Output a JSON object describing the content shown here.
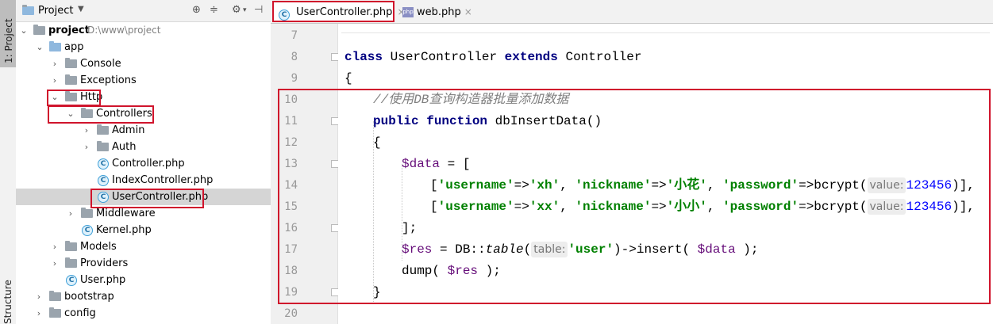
{
  "side_strip": {
    "project_tab": "1: Project",
    "structure_tab": "Structure"
  },
  "project_panel": {
    "title": "Project",
    "items": [
      {
        "label": "project",
        "path": "D:\\www\\project",
        "type": "folder-root",
        "expanded": true
      },
      {
        "label": "app",
        "type": "folder-blue",
        "expanded": true
      },
      {
        "label": "Console",
        "type": "folder",
        "expanded": false
      },
      {
        "label": "Exceptions",
        "type": "folder",
        "expanded": false
      },
      {
        "label": "Http",
        "type": "folder",
        "expanded": true
      },
      {
        "label": "Controllers",
        "type": "folder",
        "expanded": true
      },
      {
        "label": "Admin",
        "type": "folder",
        "expanded": false
      },
      {
        "label": "Auth",
        "type": "folder",
        "expanded": false
      },
      {
        "label": "Controller.php",
        "type": "class-file"
      },
      {
        "label": "IndexController.php",
        "type": "class-file"
      },
      {
        "label": "UserController.php",
        "type": "class-file",
        "selected": true
      },
      {
        "label": "Middleware",
        "type": "folder",
        "expanded": false
      },
      {
        "label": "Kernel.php",
        "type": "class-file"
      },
      {
        "label": "Models",
        "type": "folder",
        "expanded": false
      },
      {
        "label": "Providers",
        "type": "folder",
        "expanded": false
      },
      {
        "label": "User.php",
        "type": "class-file"
      },
      {
        "label": "bootstrap",
        "type": "folder",
        "expanded": false
      },
      {
        "label": "config",
        "type": "folder",
        "expanded": false
      }
    ]
  },
  "editor_tabs": [
    {
      "label": "UserController.php",
      "icon": "class-icon",
      "active": true
    },
    {
      "label": "web.php",
      "icon": "php-file-icon",
      "active": false
    }
  ],
  "icons": {
    "class_letter": "C",
    "php_letters": "php",
    "close": "×"
  },
  "editor": {
    "line_numbers": [
      "7",
      "8",
      "9",
      "10",
      "11",
      "12",
      "13",
      "14",
      "15",
      "16",
      "17",
      "18",
      "19",
      "20"
    ],
    "hints": {
      "value": "value:",
      "table": "table:"
    },
    "code": {
      "l8_kw1": "class",
      "l8_name": " UserController ",
      "l8_kw2": "extends",
      "l8_parent": " Controller",
      "l9": "{",
      "l10": "//使用DB查询构造器批量添加数据",
      "l11_kw1": "public",
      "l11_kw2": "function",
      "l11_name": " dbInsertData()",
      "l12": "{",
      "l13_var": "$data",
      "l13_rest": " = [",
      "l14_a": "[",
      "l14_k1": "'username'",
      "l14_op1": "=>",
      "l14_v1": "'xh'",
      "l14_c1": ", ",
      "l14_k2": "'nickname'",
      "l14_op2": "=>",
      "l14_v2": "'小花'",
      "l14_c2": ", ",
      "l14_k3": "'password'",
      "l14_op3": "=>bcrypt(",
      "l14_num": "123456",
      "l14_end": ")],",
      "l15_a": "[",
      "l15_k1": "'username'",
      "l15_op1": "=>",
      "l15_v1": "'xx'",
      "l15_c1": ", ",
      "l15_k2": "'nickname'",
      "l15_op2": "=>",
      "l15_v2": "'小小'",
      "l15_c2": ", ",
      "l15_k3": "'password'",
      "l15_op3": "=>bcrypt(",
      "l15_num": "123456",
      "l15_end": ")],",
      "l16": "];",
      "l17_var": "$res",
      "l17_a": " = DB::",
      "l17_fn": "table",
      "l17_b": "(",
      "l17_str": "'user'",
      "l17_c": ")->insert( ",
      "l17_var2": "$data",
      "l17_d": " );",
      "l18_a": "dump( ",
      "l18_var": "$res",
      "l18_b": " );",
      "l19": "}"
    }
  },
  "colors": {
    "highlight_border": "#d0142c",
    "keyword": "#000080",
    "string": "#008000",
    "variable": "#660e7a",
    "number": "#0000ff",
    "comment": "#808080"
  }
}
